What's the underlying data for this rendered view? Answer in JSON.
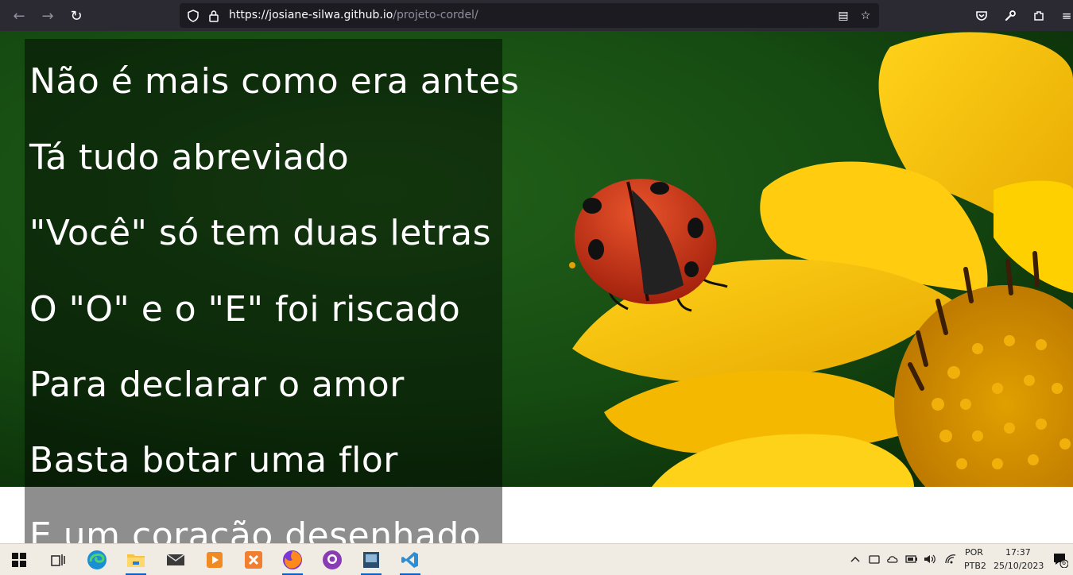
{
  "browser": {
    "back_icon": "←",
    "forward_icon": "→",
    "reload_icon": "↻",
    "url_host": "https://josiane-silwa.github.io",
    "url_path": "/projeto-cordel/",
    "reader_icon": "▤",
    "bookmark_icon": "☆",
    "pocket_icon": "⛉",
    "extensions_icon": "🔧",
    "share_icon": "⤴",
    "menu_icon": "≡"
  },
  "poem": {
    "lines": [
      "Não é mais como era antes",
      "Tá tudo abreviado",
      "\"Você\" só tem duas letras",
      "O \"O\" e o \"E\" foi riscado",
      "Para declarar o amor",
      "Basta botar uma flor",
      "E um coração desenhado"
    ]
  },
  "taskbar": {
    "lang_top": "POR",
    "lang_bottom": "PTB2",
    "time": "17:37",
    "date": "25/10/2023",
    "notification_count": "6",
    "colors": {
      "accent": "#0a5fbf",
      "edge": "#1a8fd6",
      "vscode": "#2c8ed6",
      "github": "#8a3cb5",
      "xampp": "#f08030"
    }
  }
}
